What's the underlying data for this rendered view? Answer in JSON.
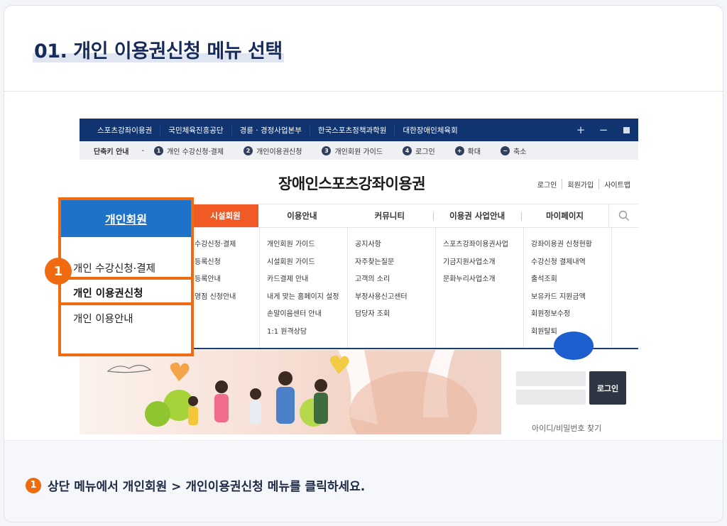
{
  "title": "01. 개인 이용권신청 메뉴 선택",
  "topbar": {
    "items": [
      "스포츠강좌이용권",
      "국민체육진흥공단",
      "경륜 · 경정사업본부",
      "한국스포츠정책과학원",
      "대한장애인체육회"
    ],
    "controls": [
      "+",
      "−",
      "■"
    ]
  },
  "shortcut": {
    "label": "단축키 안내",
    "dash": "-",
    "items": [
      {
        "num": "1",
        "text": "개인 수강신청·결제"
      },
      {
        "num": "2",
        "text": "개인이용권신청"
      },
      {
        "num": "3",
        "text": "개인회원 가이드"
      },
      {
        "num": "4",
        "text": "로그인"
      },
      {
        "num": "+",
        "text": "확대"
      },
      {
        "num": "−",
        "text": "축소"
      }
    ]
  },
  "site": {
    "title": "장애인스포츠강좌이용권",
    "links": [
      "로그인",
      "회원가입",
      "사이트맵"
    ]
  },
  "gnb": [
    "시설회원",
    "이용안내",
    "커뮤니티",
    "이용권 사업안내",
    "마이페이지"
  ],
  "dropdown": {
    "col1": [
      "수강신청·결제",
      "등록신청",
      "등록안내",
      "영점 신청안내"
    ],
    "col2": [
      "개인회원 가이드",
      "시설회원 가이드",
      "카드결제 안내",
      "내게 맞는 홈페이지 설정",
      "손말이음센터 안내",
      "1:1 원격상담"
    ],
    "col3": [
      "공지사항",
      "자주찾는질문",
      "고객의 소리",
      "부정사용신고센터",
      "담당자 조회"
    ],
    "col4": [
      "스포츠강좌이용권사업",
      "기금지원사업소개",
      "문화누리사업소개"
    ],
    "col5": [
      "강좌이용권 신청현황",
      "수강신청 결제내역",
      "출석조회",
      "보유카드 지원금액",
      "회원정보수정",
      "회원탈퇴"
    ]
  },
  "login": {
    "button": "로그인",
    "find": "아이디/비밀번호 찾기"
  },
  "panel": {
    "header": "개인회원",
    "items": [
      "개인 수강신청·결제",
      "개인 이용권신청",
      "개인 이용안내"
    ],
    "step": "1"
  },
  "footer": {
    "step": "1",
    "text": "상단 메뉴에서 개인회원 > 개인이용권신청 메뉴를 클릭하세요."
  },
  "colors": {
    "accent": "#f06a0f",
    "navy": "#103470",
    "blue": "#1e73c8"
  }
}
